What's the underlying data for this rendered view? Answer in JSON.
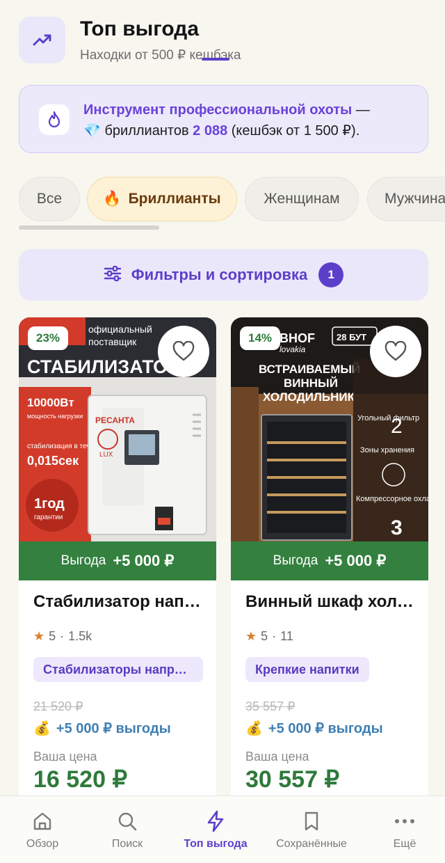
{
  "header": {
    "title": "Топ выгода",
    "subtitle": "Находки от 500 ₽ кешбэка",
    "icon": "trending-up-icon"
  },
  "promo": {
    "icon": "flame-icon",
    "strong_text": "Инструмент профессиональной охоты",
    "dash": " —",
    "gem_emoji": "💎",
    "diamonds_label": " бриллиантов ",
    "diamonds_count": "2 088",
    "tail": " (кешбэк от 1 500 ₽)."
  },
  "chips": [
    {
      "label": "Все"
    },
    {
      "emoji": "🔥",
      "label": "Бриллианты"
    },
    {
      "label": "Женщинам"
    },
    {
      "label": "Мужчинам"
    }
  ],
  "filters": {
    "label": "Фильтры и сортировка",
    "badge": "1",
    "icon": "sliders-icon"
  },
  "products": [
    {
      "discount": "23%",
      "benefit_label": "Выгода",
      "benefit_value": "+5 000 ₽",
      "title": "Стабилизатор напряжения",
      "rating": "5",
      "reviews": "1.5k",
      "category": "Стабилизаторы напряжения",
      "old_price": "21 520 ₽",
      "cashback_emoji": "💰",
      "cashback": "+5 000 ₽ выгоды",
      "price_label": "Ваша цена",
      "price": "16 520 ₽",
      "image": {
        "brand_line1": "официальный",
        "brand_line2": "поставщик",
        "headline": "СТАБИЛИЗАТОР",
        "power": "10000Вт",
        "power_sub": "мощность нагрузки",
        "stab": "стабилизация в течении",
        "stab_value": "0,015сек",
        "warranty": "1год",
        "warranty_sub": "гарантии",
        "device_brand": "РЕСАНТА",
        "device_model": "LUX"
      }
    },
    {
      "discount": "14%",
      "benefit_label": "Выгода",
      "benefit_value": "+5 000 ₽",
      "title": "Винный шкаф холодильник",
      "rating": "5",
      "reviews": "11",
      "category": "Крепкие напитки",
      "old_price": "35 557 ₽",
      "cashback_emoji": "💰",
      "cashback": "+5 000 ₽ выгоды",
      "price_label": "Ваша цена",
      "price": "30 557 ₽",
      "image": {
        "brand": "BHOF",
        "brand_sub": "lovakia",
        "bottles": "28 БУТ",
        "headline1": "ВСТРАИВАЕМЫЙ",
        "headline2": "ВИННЫЙ",
        "headline3": "ХОЛОДИЛЬНИК",
        "f1": "Угольный фильтр",
        "f2_num": "2",
        "f2": "Зоны хранения",
        "f3": "Компрессорное охлаждение",
        "f4_num": "3"
      }
    }
  ],
  "tabbar": [
    {
      "label": "Обзор",
      "icon": "home-icon"
    },
    {
      "label": "Поиск",
      "icon": "search-icon"
    },
    {
      "label": "Топ выгода",
      "icon": "lightning-icon",
      "active": true
    },
    {
      "label": "Сохранённые",
      "icon": "bookmark-icon"
    },
    {
      "label": "Ещё",
      "icon": "more-icon"
    }
  ],
  "colors": {
    "accent": "#5b3fc9",
    "benefit_green": "#33803f",
    "price_green": "#2e7a3b",
    "cashback_blue": "#3f7fb3"
  }
}
